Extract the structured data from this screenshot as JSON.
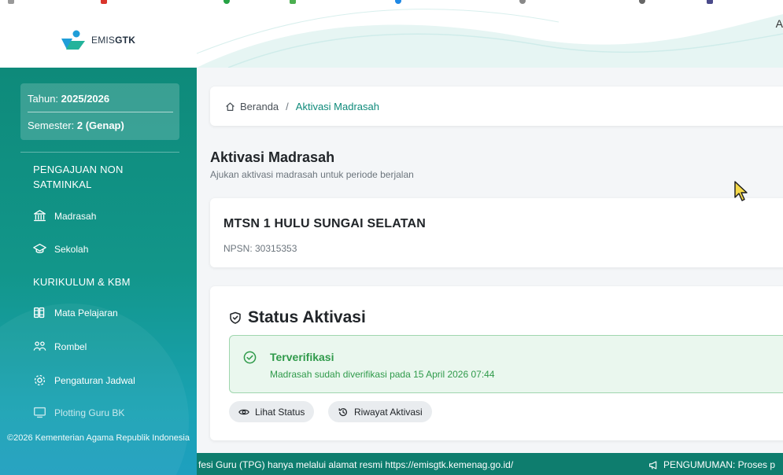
{
  "app": {
    "logo_text_prefix": "EMIS",
    "logo_text_suffix": "GTK",
    "header_cut_char": "A"
  },
  "sidebar": {
    "period": {
      "year_label": "Tahun:",
      "year_value": "2025/2026",
      "semester_label": "Semester:",
      "semester_value": "2 (Genap)"
    },
    "sections": [
      {
        "title": "PENGAJUAN NON SATMINKAL",
        "items": [
          {
            "label": "Madrasah",
            "icon": "building-columns-icon"
          },
          {
            "label": "Sekolah",
            "icon": "graduation-cap-icon"
          }
        ]
      },
      {
        "title": "KURIKULUM & KBM",
        "items": [
          {
            "label": "Mata Pelajaran",
            "icon": "books-icon"
          },
          {
            "label": "Rombel",
            "icon": "users-group-icon"
          },
          {
            "label": "Pengaturan Jadwal",
            "icon": "gear-icon"
          },
          {
            "label": "Plotting Guru BK",
            "icon": "board-icon"
          }
        ]
      }
    ],
    "footer": "©2026 Kementerian Agama Republik Indonesia"
  },
  "breadcrumb": {
    "home": "Beranda",
    "separator": "/",
    "current": "Aktivasi Madrasah"
  },
  "page": {
    "title": "Aktivasi Madrasah",
    "subtitle": "Ajukan aktivasi madrasah untuk periode berjalan"
  },
  "school": {
    "name": "MTSN 1 HULU SUNGAI SELATAN",
    "npsn": "NPSN: 30315353"
  },
  "status": {
    "title": "Status Aktivasi",
    "alert_title": "Terverifikasi",
    "alert_message": "Madrasah sudah diverifikasi pada 15 April 2026 07:44",
    "buttons": {
      "view_status": "Lihat Status",
      "history": "Riwayat Aktivasi"
    }
  },
  "ticker": {
    "text": "fesi Guru (TPG) hanya melalui alamat resmi https://emisgtk.kemenag.go.id/",
    "announcement": "PENGUMUMAN: Proses p"
  },
  "colors": {
    "primary": "#0e8a7a",
    "success": "#2f9a4a",
    "success_bg": "#eaf7ee",
    "ticker_bg": "#0e7d6e"
  }
}
